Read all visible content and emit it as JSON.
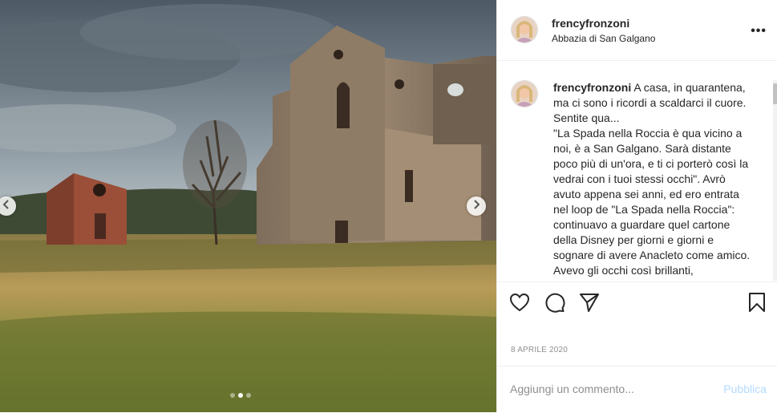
{
  "post": {
    "username": "frencyfronzoni",
    "location": "Abbazia di San Galgano",
    "more_label": "•••",
    "caption_text": " A casa, in quarantena, ma ci sono i ricordi a scaldarci il cuore. Sentite qua...\n\"La Spada nella Roccia è qua vicino a noi, è a San Galgano. Sarà distante poco più di un'ora, e ti ci porterò così la vedrai con i tuoi stessi occhi\". Avrò avuto appena sei anni, ed ero entrata nel loop de \"La Spada nella Roccia\": continuavo a guardare quel cartone della Disney per giorni e giorni e sognare di avere Anacleto come amico. Avevo gli occhi così brillanti,",
    "date": "8 APRILE 2020"
  },
  "carousel": {
    "slide_count": 3,
    "active_index": 1
  },
  "icons": {
    "more": "more-options-icon",
    "like": "heart-icon",
    "comment": "comment-bubble-icon",
    "share": "paper-plane-icon",
    "save": "bookmark-icon",
    "prev": "chevron-left-icon",
    "next": "chevron-right-icon"
  },
  "add_comment": {
    "placeholder": "Aggiungi un commento...",
    "publish_label": "Pubblica"
  },
  "colors": {
    "publish_disabled": "#b3dbff",
    "text_primary": "#262626",
    "text_secondary": "#8e8e8e",
    "divider": "#efefef"
  }
}
